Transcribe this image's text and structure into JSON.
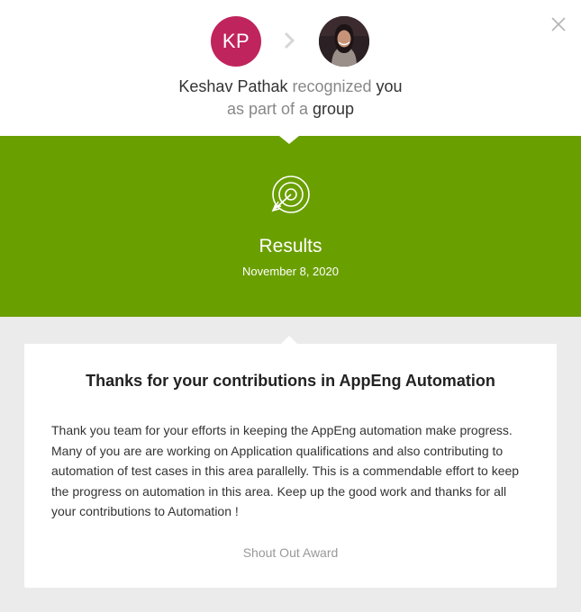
{
  "header": {
    "giver_initials": "KP",
    "giver_name": "Keshav Pathak",
    "verb": " recognized ",
    "recipient": "you",
    "line2_prefix": "as part of a ",
    "line2_group": "group"
  },
  "icons": {
    "close": "close-icon",
    "separator": "chevron-right-icon",
    "award": "target-arrow-icon"
  },
  "award": {
    "title": "Results",
    "date": "November 8, 2020"
  },
  "card": {
    "title": "Thanks for your contributions in AppEng Automation",
    "message": "Thank you team for your efforts in keeping the AppEng automation make progress. Many of you are are working on Application qualifications and also contributing to automation of test cases in this area parallelly. This is a commendable effort to keep the progress on automation in this area. Keep up the good work and thanks for all your contributions to Automation !",
    "type": "Shout Out Award"
  },
  "colors": {
    "banner": "#6a9f00",
    "giver_avatar": "#c0245c",
    "background": "#ebebeb"
  }
}
